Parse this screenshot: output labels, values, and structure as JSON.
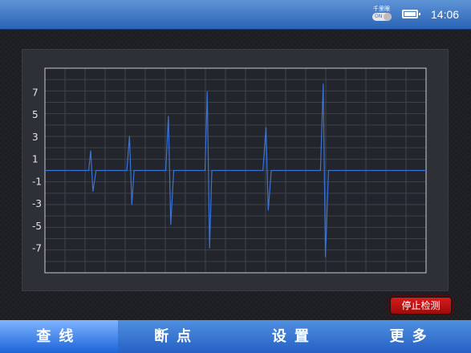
{
  "status_bar": {
    "hotspot_label": "千里眼",
    "hotspot_toggle": "ON",
    "battery_level": 1.0,
    "time": "14:06"
  },
  "chart_data": {
    "type": "line",
    "title": "",
    "xlabel": "",
    "ylabel": "",
    "yticks": [
      7,
      5,
      3,
      1,
      -1,
      -3,
      -5,
      -7
    ],
    "ylim": [
      -9.2,
      9.2
    ],
    "xlim": [
      0,
      100
    ],
    "grid": true,
    "line_color": "#3a73d6",
    "series": [
      {
        "x": [
          0,
          11.5,
          12,
          12.6,
          13.4,
          14,
          21.5,
          22.2,
          22.8,
          23.4,
          24,
          31.7,
          32.4,
          33,
          33.8,
          34.3,
          42,
          42.6,
          43.2,
          43.8,
          44.4,
          57.2,
          58,
          58.6,
          59.4,
          60,
          72.3,
          73,
          73.6,
          74.4,
          75,
          100
        ],
        "y": [
          0,
          0,
          1.8,
          -1.9,
          0,
          0,
          0,
          3.1,
          -3.1,
          0,
          0,
          0,
          4.9,
          -4.9,
          0,
          0,
          0,
          7.1,
          -7,
          0,
          0,
          0,
          3.9,
          -3.6,
          0,
          0,
          0,
          7.8,
          -7.8,
          0,
          0,
          0
        ]
      }
    ]
  },
  "chart_data_extra_note": "",
  "buttons": {
    "stop_detect": "停止检测"
  },
  "nav": {
    "items": [
      {
        "label": "查线",
        "active": true
      },
      {
        "label": "断点",
        "active": false
      },
      {
        "label": "设置",
        "active": false
      },
      {
        "label": "更多",
        "active": false
      }
    ]
  },
  "colors": {
    "status_bar": "#2b63b6",
    "nav_bar": "#2561c4",
    "stop_button": "#c41313",
    "trace": "#3a73d6"
  }
}
